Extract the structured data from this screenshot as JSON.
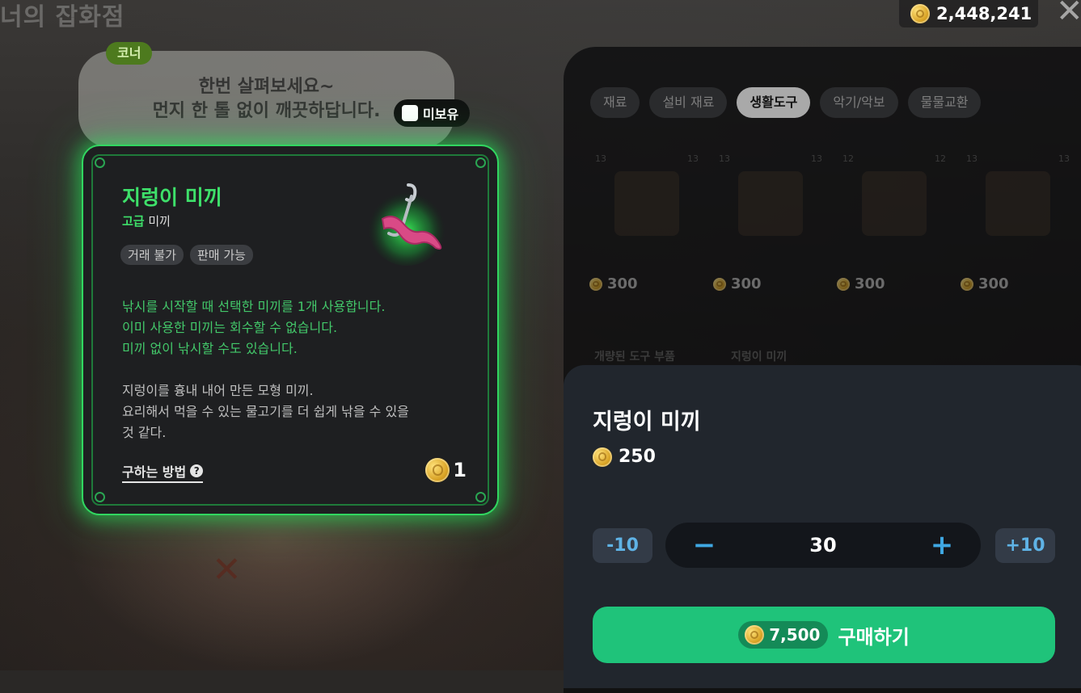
{
  "shop": {
    "title": "너의 잡화점"
  },
  "currency": {
    "value": "2,448,241"
  },
  "bubble": {
    "tag": "코너",
    "line1": "한번 살펴보세요~",
    "line2": "먼지 한 톨 없이 깨끗하답니다.",
    "status": "미보유"
  },
  "item": {
    "name": "지렁이 미끼",
    "grade_strong": "고급",
    "grade_rest": " 미끼",
    "tags": [
      "거래 불가",
      "판매 가능"
    ],
    "effect": [
      "낚시를 시작할 때 선택한 미끼를 1개 사용합니다.",
      "이미 사용한 미끼는 회수할 수 없습니다.",
      "미끼 없이 낚시할 수도 있습니다."
    ],
    "description": [
      "지렁이를 흉내 내어 만든 모형 미끼.",
      "요리해서 먹을 수 있는 물고기를 더 쉽게 낚을 수 있을",
      "것 같다."
    ],
    "howto": "구하는 방법",
    "owned_count": "1"
  },
  "tabs": [
    {
      "label": "재료",
      "active": false
    },
    {
      "label": "설비 재료",
      "active": false
    },
    {
      "label": "생활도구",
      "active": true
    },
    {
      "label": "악기/악보",
      "active": false
    },
    {
      "label": "물물교환",
      "active": false
    }
  ],
  "grid": [
    {
      "lvl": "13",
      "count": "13",
      "price": "300"
    },
    {
      "lvl": "13",
      "count": "13",
      "price": "300"
    },
    {
      "lvl": "12",
      "count": "12",
      "price": "300"
    },
    {
      "lvl": "13",
      "count": "13",
      "price": "300"
    }
  ],
  "grid_labels": [
    "개량된 도구 부품",
    "지렁이 미끼"
  ],
  "purchase": {
    "title": "지렁이 미끼",
    "unit_price": "250",
    "minus10": "-10",
    "plus10": "+10",
    "minus": "−",
    "plus": "+",
    "quantity": "30",
    "total": "7,500",
    "buy_label": "구매하기"
  },
  "colors": {
    "accent_green": "#3ee06a",
    "buy_green": "#1fc37a",
    "step_blue": "#3fa8e3"
  }
}
